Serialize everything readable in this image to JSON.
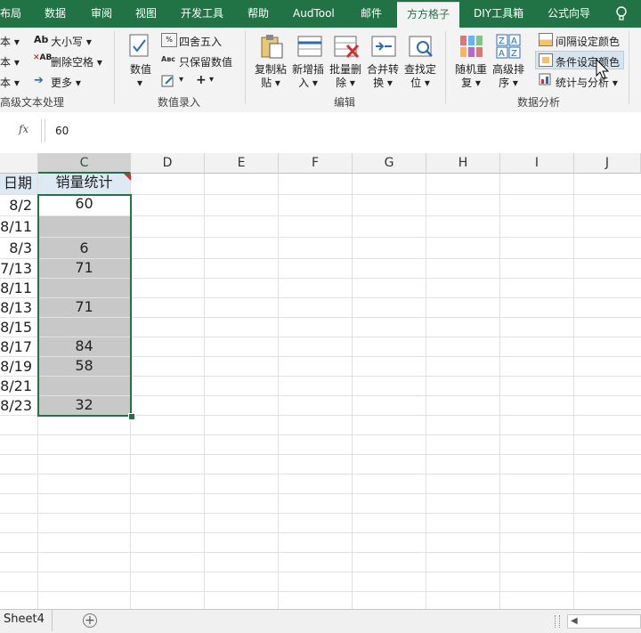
{
  "tabs": [
    {
      "label": "布局",
      "active": false
    },
    {
      "label": "数据",
      "active": false
    },
    {
      "label": "审阅",
      "active": false
    },
    {
      "label": "视图",
      "active": false
    },
    {
      "label": "开发工具",
      "active": false
    },
    {
      "label": "帮助",
      "active": false
    },
    {
      "label": "AudTool",
      "active": false
    },
    {
      "label": "邮件",
      "active": false
    },
    {
      "label": "方方格子",
      "active": true
    },
    {
      "label": "DIY工具箱",
      "active": false
    },
    {
      "label": "公式向导",
      "active": false
    }
  ],
  "ribbon": {
    "group1": {
      "items_left": [
        "本 ▾",
        "本 ▾",
        "本 ▾"
      ],
      "items_right": [
        "大小写 ▾",
        "删除空格 ▾",
        "更多 ▾"
      ],
      "label": "高级文本处理"
    },
    "group2": {
      "numeric_label": "数值",
      "items": [
        "四舍五入",
        "只保留数值"
      ],
      "label": "数值录入"
    },
    "group3": {
      "buttons": [
        {
          "line1": "复制粘",
          "line2": "贴 ▾"
        },
        {
          "line1": "新增插",
          "line2": "入 ▾"
        },
        {
          "line1": "批量删",
          "line2": "除 ▾"
        },
        {
          "line1": "合并转",
          "line2": "换 ▾"
        },
        {
          "line1": "查找定",
          "line2": "位 ▾"
        }
      ],
      "label": "编辑"
    },
    "group4": {
      "buttons": [
        {
          "line1": "随机重",
          "line2": "复 ▾"
        },
        {
          "line1": "高级排",
          "line2": "序 ▾"
        }
      ],
      "items": [
        "间隔设定颜色",
        "条件设定颜色",
        "统计与分析 ▾"
      ],
      "label": "数据分析"
    }
  },
  "formula_bar": {
    "fx": "fx",
    "value": "60"
  },
  "columns": [
    "C",
    "D",
    "E",
    "F",
    "G",
    "H",
    "I",
    "J"
  ],
  "rows": [
    {
      "a": "日期",
      "c": "销量统计",
      "header": true
    },
    {
      "a": "8/2",
      "c": "60",
      "hl": false
    },
    {
      "a": "8/11",
      "c": "",
      "hl": true
    },
    {
      "a": "8/3",
      "c": "6",
      "hl": true
    },
    {
      "a": "7/13",
      "c": "71",
      "hl": true
    },
    {
      "a": "8/11",
      "c": "",
      "hl": true
    },
    {
      "a": "8/13",
      "c": "71",
      "hl": true
    },
    {
      "a": "8/15",
      "c": "",
      "hl": true
    },
    {
      "a": "8/17",
      "c": "84",
      "hl": true
    },
    {
      "a": "8/19",
      "c": "58",
      "hl": true
    },
    {
      "a": "8/21",
      "c": "",
      "hl": true
    },
    {
      "a": "8/23",
      "c": "32",
      "hl": true
    }
  ],
  "sheet_tab": "Sheet4",
  "colors": {
    "excel_green": "#217346",
    "highlight": "#c8c8c8",
    "header_fill": "#dde9f5"
  }
}
